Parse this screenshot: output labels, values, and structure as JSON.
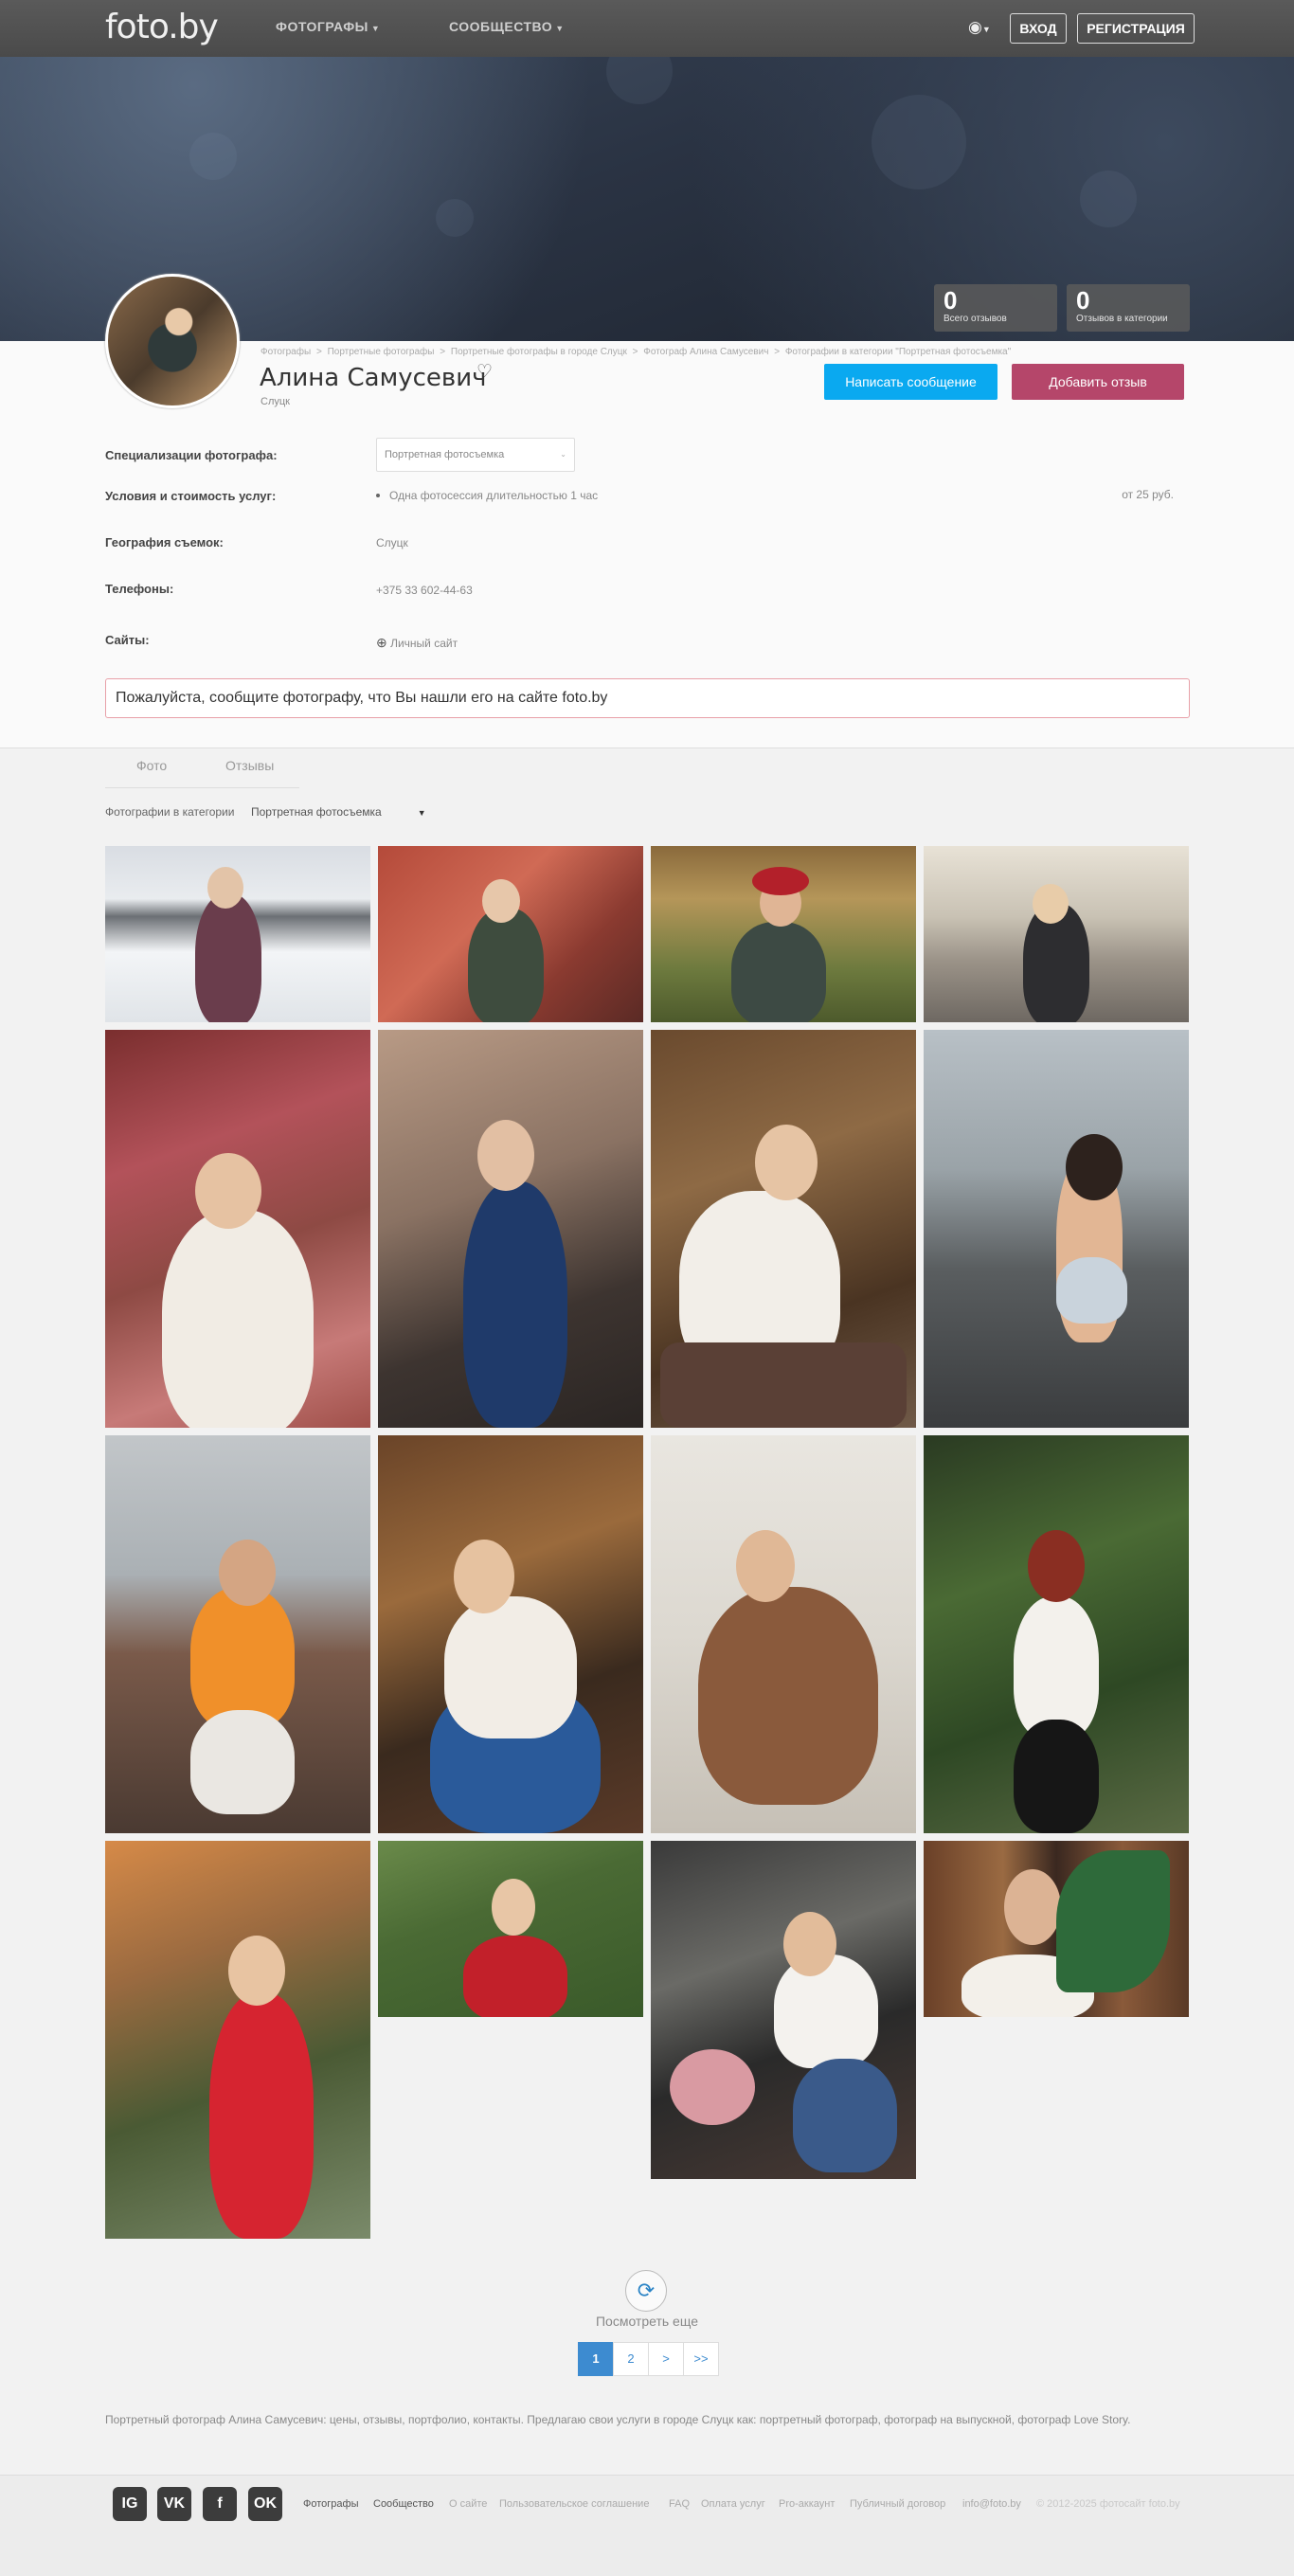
{
  "header": {
    "logo": "foto.by",
    "menu": [
      {
        "label": "ФОТОГРАФЫ"
      },
      {
        "label": "СООБЩЕСТВО"
      }
    ],
    "login": "ВХОД",
    "register": "РЕГИСТРАЦИЯ"
  },
  "stats": [
    {
      "value": "0",
      "label": "Всего отзывов"
    },
    {
      "value": "0",
      "label": "Отзывов в категории"
    }
  ],
  "breadcrumbs": [
    "Фотографы",
    "Портретные фотографы",
    "Портретные фотографы в городе Слуцк",
    "Фотограф Алина Самусевич",
    "Фотографии в категории \"Портретная фотосъемка\""
  ],
  "breadcrumb_sep": ">",
  "profile": {
    "name": "Алина Самусевич",
    "city": "Слуцк",
    "message_button": "Написать сообщение",
    "review_button": "Добавить отзыв"
  },
  "info": {
    "specialization_label": "Специализации фотографа:",
    "specialization_value": "Портретная фотосъемка",
    "services_label": "Условия и стоимость услуг:",
    "service_item": "Одна фотосессия длительностью 1 час",
    "service_price": "от 25 руб.",
    "geography_label": "География съемок:",
    "geography_value": "Слуцк",
    "phones_label": "Телефоны:",
    "phone_value": "+375 33 602-44-63",
    "sites_label": "Сайты:",
    "site_value": "Личный сайт"
  },
  "notice": "Пожалуйста, сообщите фотографу, что Вы нашли его на сайте foto.by",
  "tabs": [
    {
      "label": "Фото"
    },
    {
      "label": "Отзывы"
    }
  ],
  "category_filter": {
    "label": "Фотографии в категории",
    "value": "Портретная фотосъемка"
  },
  "load_more": "Посмотреть еще",
  "pagination": [
    "1",
    "2",
    ">",
    ">>"
  ],
  "seo_text": "Портретный фотограф Алина Самусевич: цены, отзывы, портфолио, контакты. Предлагаю свои услуги в городе Слуцк как: портретный фотограф, фотограф на выпускной, фотограф Love Story.",
  "footer": {
    "social": [
      {
        "label": "IG"
      },
      {
        "label": "VK"
      },
      {
        "label": "f"
      },
      {
        "label": "OK"
      }
    ],
    "links": [
      "Фотографы",
      "Сообщество",
      "О сайте",
      "Пользовательское соглашение",
      "FAQ",
      "Оплата услуг",
      "Pro-аккаунт",
      "Публичный договор",
      "info@foto.by"
    ],
    "copyright": "© 2012-2025 фотосайт foto.by"
  },
  "colors": {
    "accent_blue": "#0aa9f0",
    "review_pink": "#b5466a",
    "pager_active": "#3d8bd0"
  }
}
